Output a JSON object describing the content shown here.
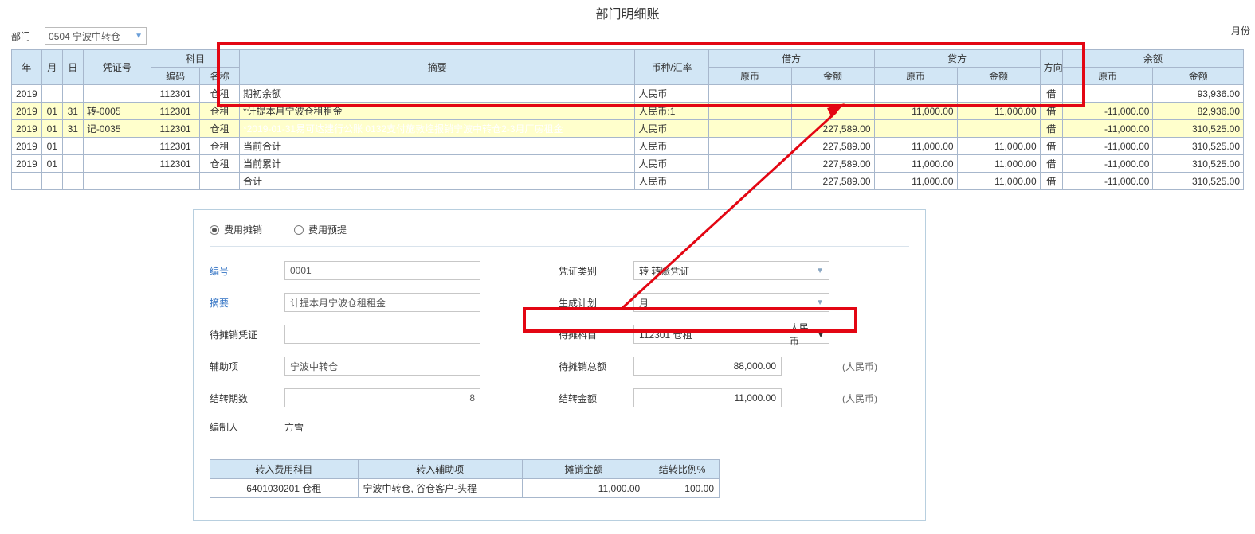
{
  "title": "部门明细账",
  "month_label": "月份",
  "dept_label": "部门",
  "dept_value": "0504 宁波中转仓",
  "headers": {
    "year": "年",
    "month": "月",
    "day": "日",
    "voucher": "凭证号",
    "subject": "科目",
    "subject_code": "编码",
    "subject_name": "名称",
    "summary": "摘要",
    "currency": "币种/汇率",
    "debit": "借方",
    "credit": "贷方",
    "orig": "原币",
    "amount": "金额",
    "dir": "方向",
    "balance": "余额"
  },
  "rows": [
    {
      "year": "2019",
      "month": "",
      "day": "",
      "voucher": "",
      "code": "112301",
      "name": "仓租",
      "summary": "期初余额",
      "cur": "人民币",
      "deb_orig": "",
      "deb_amt": "",
      "cre_orig": "",
      "cre_amt": "",
      "dir": "借",
      "bal_orig": "",
      "bal_amt": "93,936.00",
      "cls": ""
    },
    {
      "year": "2019",
      "month": "01",
      "day": "31",
      "voucher": "转-0005",
      "code": "112301",
      "name": "仓租",
      "summary": "*计提本月宁波仓租租金",
      "cur": "人民币:1",
      "deb_orig": "",
      "deb_amt": "",
      "cre_orig": "11,000.00",
      "cre_amt": "11,000.00",
      "dir": "借",
      "bal_orig": "-11,000.00",
      "bal_amt": "82,936.00",
      "cls": "hl"
    },
    {
      "year": "2019",
      "month": "01",
      "day": "31",
      "voucher": "记-0035",
      "code": "112301",
      "name": "仓租",
      "summary": "*2019-01-31易可达建行公账 0132支付施敦煌报销宁波中转仓2-3月厂房租金",
      "cur": "人民币",
      "deb_orig": "",
      "deb_amt": "227,589.00",
      "cre_orig": "",
      "cre_amt": "",
      "dir": "借",
      "bal_orig": "-11,000.00",
      "bal_amt": "310,525.00",
      "cls": "hl",
      "sel": true
    },
    {
      "year": "2019",
      "month": "01",
      "day": "",
      "voucher": "",
      "code": "112301",
      "name": "仓租",
      "summary": "当前合计",
      "cur": "人民币",
      "deb_orig": "",
      "deb_amt": "227,589.00",
      "cre_orig": "11,000.00",
      "cre_amt": "11,000.00",
      "dir": "借",
      "bal_orig": "-11,000.00",
      "bal_amt": "310,525.00",
      "cls": ""
    },
    {
      "year": "2019",
      "month": "01",
      "day": "",
      "voucher": "",
      "code": "112301",
      "name": "仓租",
      "summary": "当前累计",
      "cur": "人民币",
      "deb_orig": "",
      "deb_amt": "227,589.00",
      "cre_orig": "11,000.00",
      "cre_amt": "11,000.00",
      "dir": "借",
      "bal_orig": "-11,000.00",
      "bal_amt": "310,525.00",
      "cls": ""
    },
    {
      "year": "",
      "month": "",
      "day": "",
      "voucher": "",
      "code": "",
      "name": "",
      "summary": "合计",
      "cur": "人民币",
      "deb_orig": "",
      "deb_amt": "227,589.00",
      "cre_orig": "11,000.00",
      "cre_amt": "11,000.00",
      "dir": "借",
      "bal_orig": "-11,000.00",
      "bal_amt": "310,525.00",
      "cls": ""
    }
  ],
  "form": {
    "radio1": "费用摊销",
    "radio2": "费用预提",
    "no_lbl": "编号",
    "no_val": "0001",
    "vtype_lbl": "凭证类别",
    "vtype_val": "转 转账凭证",
    "summary_lbl": "摘要",
    "summary_val": "计提本月宁波仓租租金",
    "plan_lbl": "生成计划",
    "plan_val": "月",
    "pending_voucher_lbl": "待摊销凭证",
    "pending_voucher_val": "",
    "pending_subj_lbl": "待摊科目",
    "pending_subj_val": "112301 仓租",
    "pending_subj_cur": "人民币",
    "assist_lbl": "辅助项",
    "assist_val": "宁波中转仓",
    "total_lbl": "待摊销总额",
    "total_val": "88,000.00",
    "total_unit": "(人民币)",
    "period_lbl": "结转期数",
    "period_val": "8",
    "amount_lbl": "结转金额",
    "amount_val": "11,000.00",
    "amount_unit": "(人民币)",
    "maker_lbl": "编制人",
    "maker_val": "方雪"
  },
  "sub_headers": {
    "subj": "转入费用科目",
    "assist": "转入辅助项",
    "amt": "摊销金额",
    "ratio": "结转比例%"
  },
  "sub_row": {
    "subj": "6401030201 仓租",
    "assist": "宁波中转仓, 谷仓客户-头程",
    "amt": "11,000.00",
    "ratio": "100.00"
  }
}
